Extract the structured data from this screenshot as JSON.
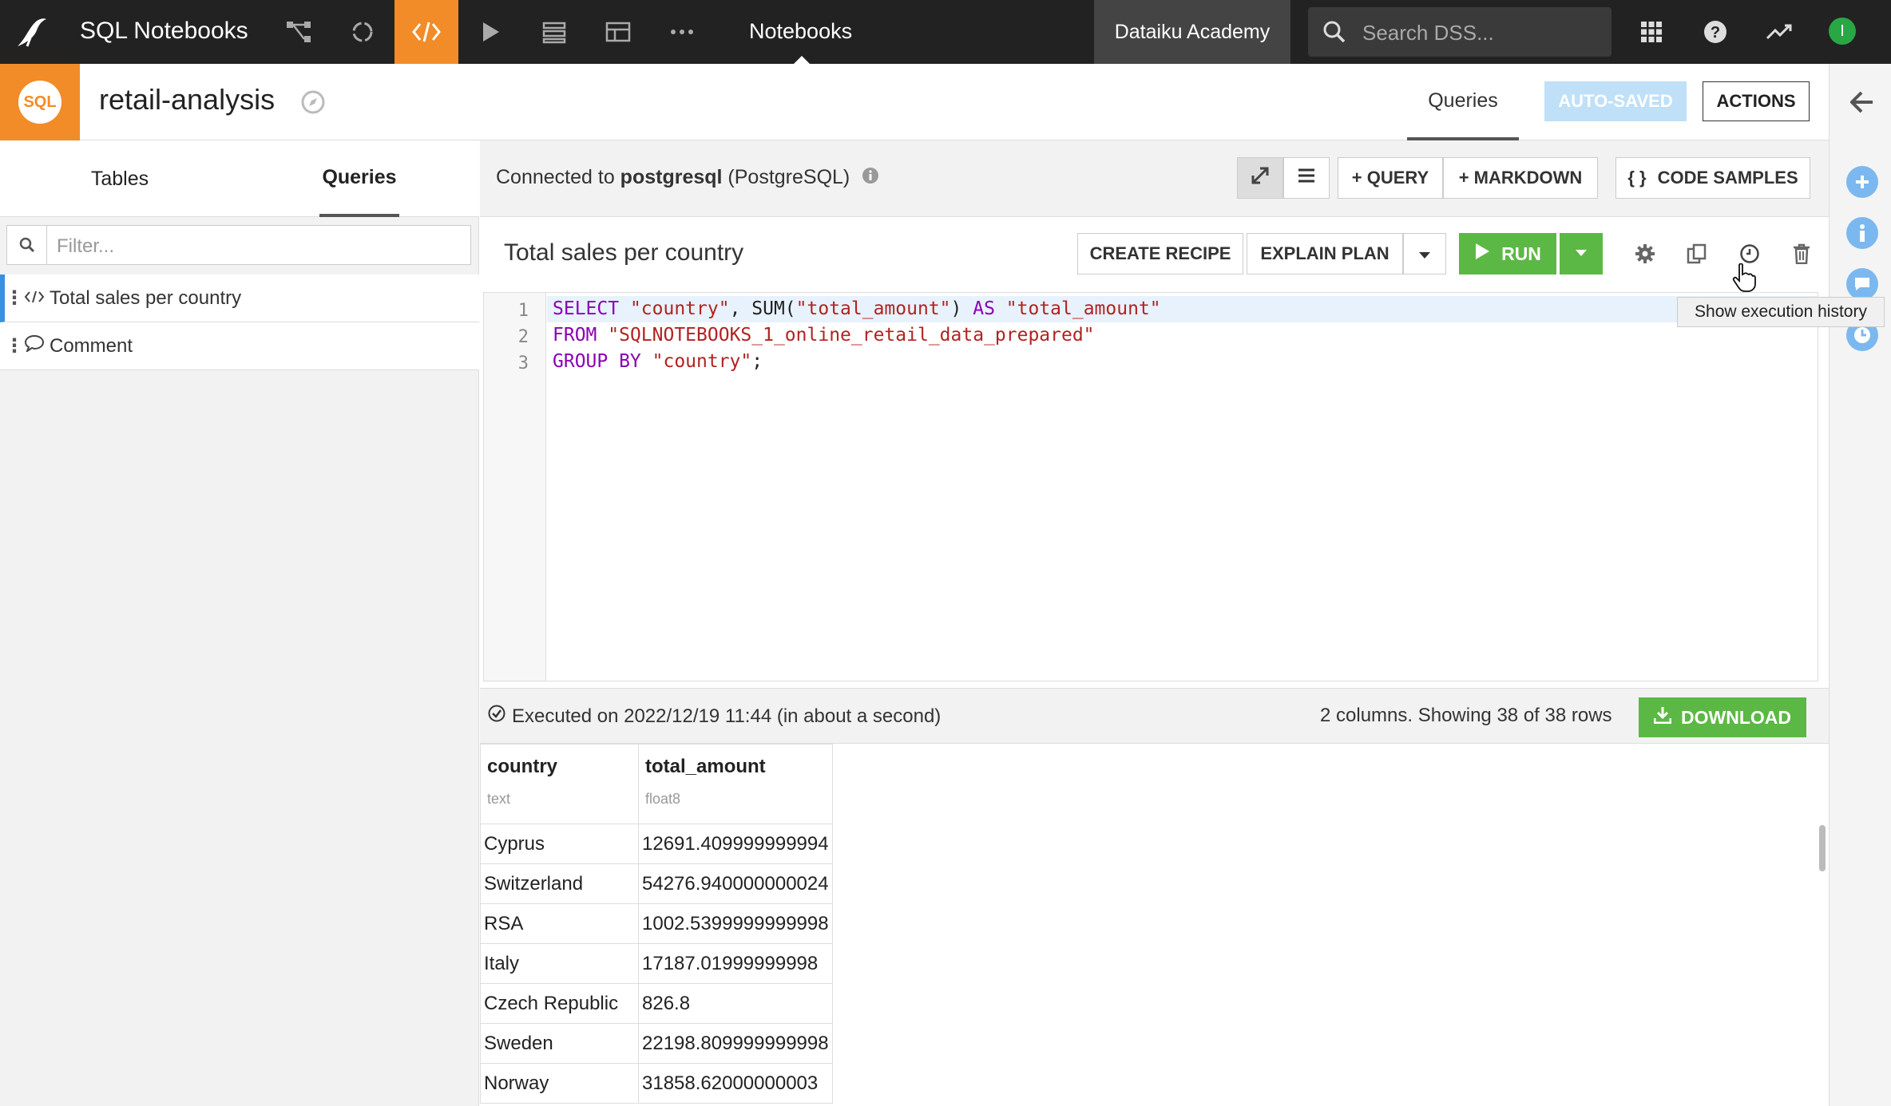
{
  "topnav": {
    "app_name": "SQL Notebooks",
    "section_label": "Notebooks",
    "academy": "Dataiku Academy",
    "search_placeholder": "Search DSS...",
    "avatar_initial": "I",
    "icons": [
      "flow-icon",
      "recycle-icon",
      "code-icon",
      "play-icon",
      "deploy-icon",
      "dashboard-icon",
      "more-icon"
    ]
  },
  "header": {
    "notebook_title": "retail-analysis",
    "sql_badge": "SQL",
    "tab_queries": "Queries",
    "autosaved": "AUTO-SAVED",
    "actions": "ACTIONS"
  },
  "left_panel": {
    "tabs": [
      "Tables",
      "Queries"
    ],
    "active_tab": "Queries",
    "filter_placeholder": "Filter...",
    "items": [
      {
        "label": "Total sales per country",
        "icon": "code-icon"
      },
      {
        "label": "Comment",
        "icon": "comment-icon"
      }
    ]
  },
  "main": {
    "connected_prefix": "Connected to",
    "connection_name": "postgresql",
    "connection_type": "(PostgreSQL)",
    "buttons": {
      "query": "+ QUERY",
      "markdown": "+ MARKDOWN",
      "code_samples": "CODE SAMPLES"
    }
  },
  "query": {
    "title": "Total sales per country",
    "create_recipe": "CREATE RECIPE",
    "explain_plan": "EXPLAIN PLAN",
    "run": "RUN",
    "tooltip": "Show execution history",
    "code": [
      {
        "n": "1",
        "tokens": [
          [
            "kw",
            "SELECT "
          ],
          [
            "str",
            "\"country\""
          ],
          [
            "pl",
            ", SUM("
          ],
          [
            "str",
            "\"total_amount\""
          ],
          [
            "pl",
            ") "
          ],
          [
            "kw",
            "AS "
          ],
          [
            "str",
            "\"total_amount\""
          ]
        ]
      },
      {
        "n": "2",
        "tokens": [
          [
            "kw",
            "FROM "
          ],
          [
            "str",
            "\"SQLNOTEBOOKS_1_online_retail_data_prepared\""
          ]
        ]
      },
      {
        "n": "3",
        "tokens": [
          [
            "kw",
            "GROUP BY "
          ],
          [
            "str",
            "\"country\""
          ],
          [
            "pl",
            ";"
          ]
        ]
      }
    ]
  },
  "results": {
    "executed": "Executed on 2022/12/19 11:44 (in about a second)",
    "rows_info": "2 columns. Showing 38 of 38 rows",
    "download": "DOWNLOAD",
    "columns": [
      {
        "name": "country",
        "type": "text"
      },
      {
        "name": "total_amount",
        "type": "float8"
      }
    ],
    "rows": [
      [
        "Cyprus",
        "12691.409999999994"
      ],
      [
        "Switzerland",
        "54276.940000000024"
      ],
      [
        "RSA",
        "1002.5399999999998"
      ],
      [
        "Italy",
        "17187.01999999998"
      ],
      [
        "Czech Republic",
        "826.8"
      ],
      [
        "Sweden",
        "22198.809999999998"
      ],
      [
        "Norway",
        "31858.62000000003"
      ]
    ]
  },
  "colors": {
    "accent_orange": "#F28C28",
    "run_green": "#5CB844",
    "topbar": "#222222",
    "active_blue": "#3B8FE0"
  }
}
